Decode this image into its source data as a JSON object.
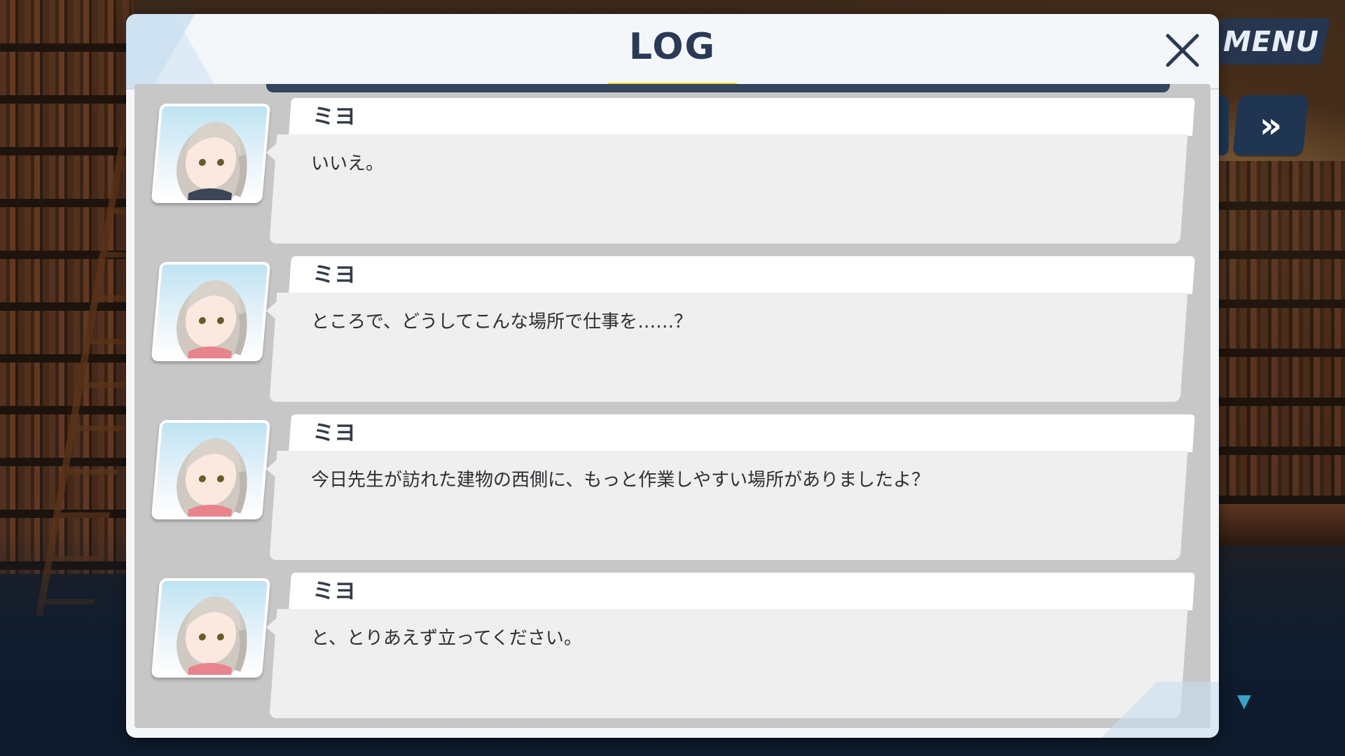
{
  "menu": {
    "label": "MENU"
  },
  "log": {
    "title": "LOG",
    "entries": [
      {
        "speaker": "ミヨ",
        "text": "いいえ。"
      },
      {
        "speaker": "ミヨ",
        "text": "ところで、どうしてこんな場所で仕事を……？"
      },
      {
        "speaker": "ミヨ",
        "text": "今日先生が訪れた建物の西側に、もっと作業しやすい場所がありましたよ？"
      },
      {
        "speaker": "ミヨ",
        "text": "と、とりあえず立ってください。"
      }
    ]
  },
  "icons": {
    "close": "close-icon",
    "fast_forward": "fast-forward-icon",
    "scroll_down": "scroll-down-icon",
    "portrait": "character-portrait"
  },
  "colors": {
    "accent_yellow": "#f2e02a",
    "title_navy": "#2a3a55",
    "hud_navy": "#1f3552",
    "scroll_cyan": "#38a3c8"
  }
}
